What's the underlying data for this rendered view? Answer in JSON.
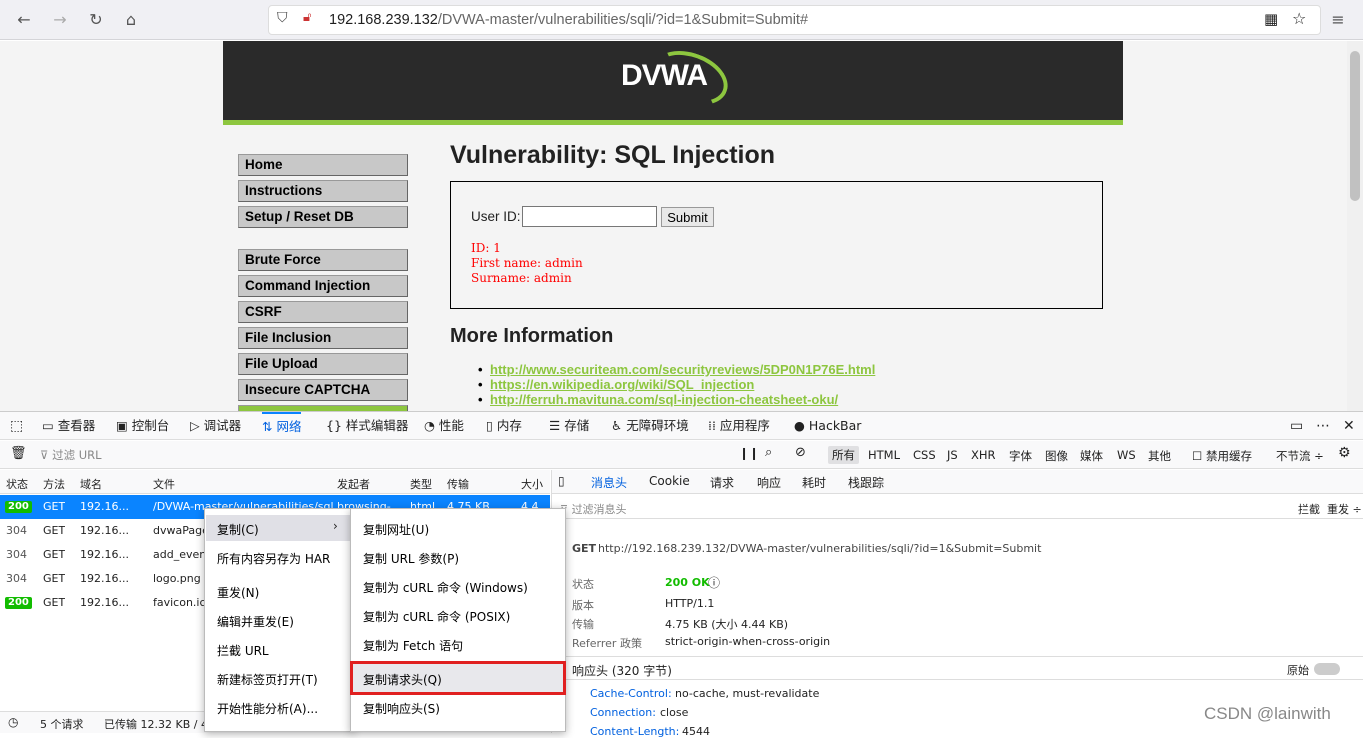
{
  "browser": {
    "url_host": "192.168.239.132",
    "url_path": "/DVWA-master/vulnerabilities/sqli/?id=1&Submit=Submit#"
  },
  "dvwa": {
    "logo": "DVWA",
    "menu": [
      "Home",
      "Instructions",
      "Setup / Reset DB",
      "Brute Force",
      "Command Injection",
      "CSRF",
      "File Inclusion",
      "File Upload",
      "Insecure CAPTCHA"
    ],
    "title": "Vulnerability: SQL Injection",
    "user_id_label": "User ID:",
    "submit_label": "Submit",
    "result": "ID: 1\nFirst name: admin\nSurname: admin",
    "more_title": "More Information",
    "links": [
      "http://www.securiteam.com/securityreviews/5DP0N1P76E.html",
      "https://en.wikipedia.org/wiki/SQL_injection",
      "http://ferruh.mavituna.com/sql-injection-cheatsheet-oku/"
    ]
  },
  "devtools": {
    "tabs": [
      "查看器",
      "控制台",
      "调试器",
      "网络",
      "样式编辑器",
      "性能",
      "内存",
      "存储",
      "无障碍环境",
      "应用程序",
      "HackBar"
    ],
    "filter_placeholder": "过滤 URL",
    "types": [
      "所有",
      "HTML",
      "CSS",
      "JS",
      "XHR",
      "字体",
      "图像",
      "媒体",
      "WS",
      "其他"
    ],
    "disable_cache": "禁用缓存",
    "throttle": "不节流 ÷",
    "columns": [
      "状态",
      "方法",
      "域名",
      "文件",
      "发起者",
      "类型",
      "传输",
      "大小"
    ],
    "requests": [
      {
        "status": "200",
        "method": "GET",
        "domain": "192.16...",
        "file": "/DVWA-master/vulnerabilities/sql",
        "initiator": "browsing-",
        "type": "html",
        "transfer": "4.75 KB",
        "size": "4.4"
      },
      {
        "status": "304",
        "method": "GET",
        "domain": "192.16...",
        "file": "dvwaPage"
      },
      {
        "status": "304",
        "method": "GET",
        "domain": "192.16...",
        "file": "add_even"
      },
      {
        "status": "304",
        "method": "GET",
        "domain": "192.16...",
        "file": "logo.png"
      },
      {
        "status": "200",
        "method": "GET",
        "domain": "192.16...",
        "file": "favicon.ic"
      }
    ],
    "status_requests": "5 个请求",
    "status_transferred": "已传输 12.32 KB / 4",
    "detail_tabs": [
      "消息头",
      "Cookie",
      "请求",
      "响应",
      "耗时",
      "栈跟踪"
    ],
    "detail_filter": "过滤消息头",
    "block": "拦截",
    "resend": "重发 ÷",
    "request_line_method": "GET",
    "request_line_url": "http://192.168.239.132/DVWA-master/vulnerabilities/sqli/?id=1&Submit=Submit",
    "summary": [
      {
        "k": "状态",
        "v": "200 OK"
      },
      {
        "k": "版本",
        "v": "HTTP/1.1"
      },
      {
        "k": "传输",
        "v": "4.75 KB (大小 4.44 KB)"
      },
      {
        "k": "Referrer 政策",
        "v": "strict-origin-when-cross-origin"
      }
    ],
    "response_headers_title": "响应头 (320 字节)",
    "raw_label": "原始",
    "response_headers": [
      {
        "k": "Cache-Control:",
        "v": "no-cache, must-revalidate"
      },
      {
        "k": "Connection:",
        "v": "close"
      },
      {
        "k": "Content-Length:",
        "v": "4544"
      }
    ]
  },
  "context_menu": {
    "items": [
      "复制(C)",
      "所有内容另存为 HAR",
      "重发(N)",
      "编辑并重发(E)",
      "拦截 URL",
      "新建标签页打开(T)",
      "开始性能分析(A)..."
    ],
    "submenu": [
      "复制网址(U)",
      "复制 URL 参数(P)",
      "复制为 cURL 命令 (Windows)",
      "复制为 cURL 命令 (POSIX)",
      "复制为 Fetch 语句",
      "复制请求头(Q)",
      "复制响应头(S)"
    ]
  },
  "watermark": "CSDN @lainwith"
}
